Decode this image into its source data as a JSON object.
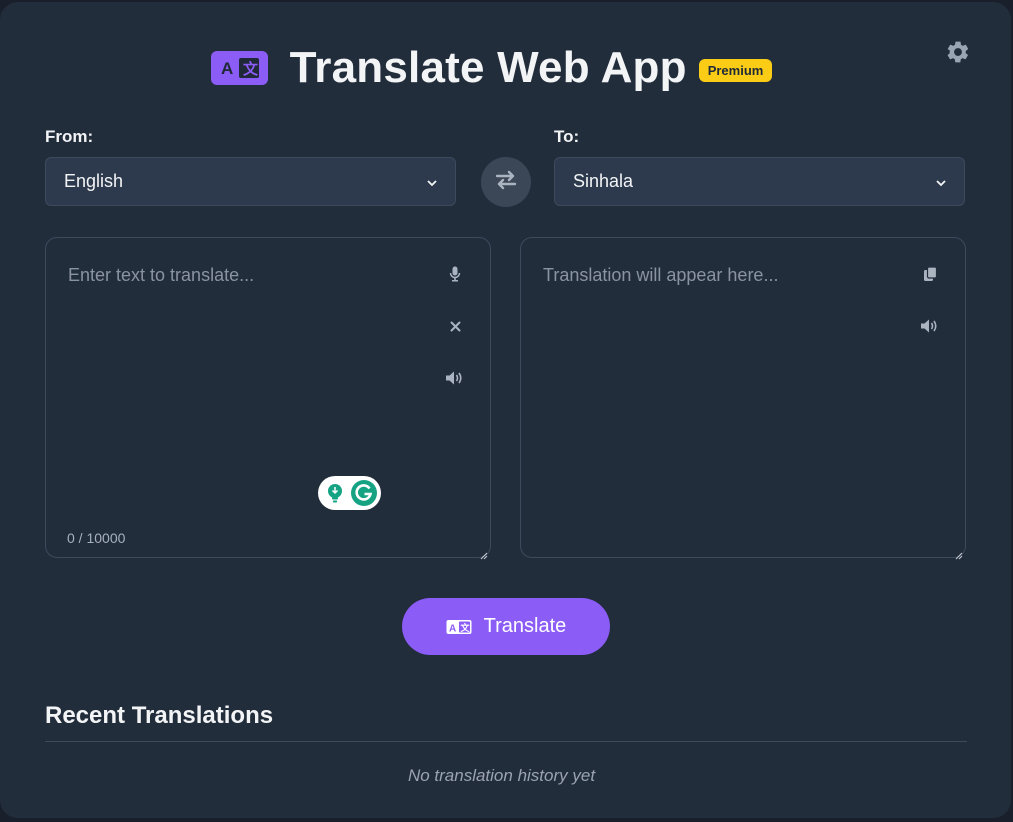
{
  "app": {
    "title": "Translate Web App",
    "badge": "Premium",
    "accent_color": "#8b5cf6",
    "badge_color": "#facc15"
  },
  "icons": {
    "logo": "translate-icon",
    "settings": "gear-icon",
    "swap": "swap-arrows-icon",
    "mic": "microphone-icon",
    "clear": "close-icon",
    "speak": "speaker-icon",
    "copy": "copy-icon"
  },
  "from": {
    "label": "From:",
    "selected": "English"
  },
  "to": {
    "label": "To:",
    "selected": "Sinhala"
  },
  "source": {
    "placeholder": "Enter text to translate...",
    "counter": "0 / 10000"
  },
  "target": {
    "placeholder": "Translation will appear here..."
  },
  "translate_button": {
    "label": "Translate"
  },
  "recent": {
    "title": "Recent Translations",
    "empty_message": "No translation history yet"
  }
}
